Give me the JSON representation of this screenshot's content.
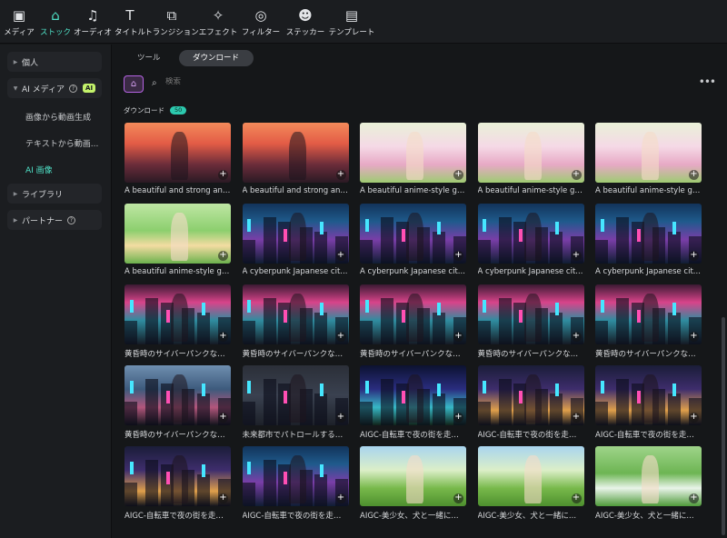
{
  "toolbar": {
    "items": [
      {
        "label": "メディア",
        "icon": "media-icon",
        "glyph": "▣"
      },
      {
        "label": "ストック",
        "icon": "stock-icon",
        "glyph": "⌂",
        "active": true
      },
      {
        "label": "オーディオ",
        "icon": "audio-icon",
        "glyph": "♫"
      },
      {
        "label": "タイトル",
        "icon": "title-icon",
        "glyph": "T"
      },
      {
        "label": "トランジション",
        "icon": "transition-icon",
        "glyph": "⧉"
      },
      {
        "label": "エフェクト",
        "icon": "effect-icon",
        "glyph": "✧"
      },
      {
        "label": "フィルター",
        "icon": "filter-icon",
        "glyph": "◎"
      },
      {
        "label": "ステッカー",
        "icon": "sticker-icon",
        "glyph": "☻"
      },
      {
        "label": "テンプレート",
        "icon": "template-icon",
        "glyph": "▤"
      }
    ]
  },
  "sidebar": {
    "personal": "個人",
    "ai_media": "AI メディア",
    "ai_badge": "AI",
    "sub_items": [
      "画像から動画生成",
      "テキストから動画...",
      "AI 画像"
    ],
    "library": "ライブラリ",
    "partner": "パートナー"
  },
  "main": {
    "tabs": [
      "ツール",
      "ダウンロード"
    ],
    "search_placeholder": "検索",
    "section_label": "ダウンロード",
    "section_count": "50",
    "accent": "#4fe0c6"
  },
  "cards": [
    {
      "caption": "A beautiful and strong ani...",
      "theme": "sunset"
    },
    {
      "caption": "A beautiful and strong ani...",
      "theme": "sunset"
    },
    {
      "caption": "A beautiful anime-style gir...",
      "theme": "girl"
    },
    {
      "caption": "A beautiful anime-style gir...",
      "theme": "girl"
    },
    {
      "caption": "A beautiful anime-style gir...",
      "theme": "girl"
    },
    {
      "caption": "A beautiful anime-style gir...",
      "theme": "meadow"
    },
    {
      "caption": "A cyberpunk Japanese cit...",
      "theme": "city"
    },
    {
      "caption": "A cyberpunk Japanese cit...",
      "theme": "city"
    },
    {
      "caption": "A cyberpunk Japanese cit...",
      "theme": "city"
    },
    {
      "caption": "A cyberpunk Japanese cit...",
      "theme": "city"
    },
    {
      "caption": "黄昏時のサイバーパンクな日...",
      "theme": "alley"
    },
    {
      "caption": "黄昏時のサイバーパンクな日...",
      "theme": "alley"
    },
    {
      "caption": "黄昏時のサイバーパンクな日...",
      "theme": "alley"
    },
    {
      "caption": "黄昏時のサイバーパンクな日...",
      "theme": "alley"
    },
    {
      "caption": "黄昏時のサイバーパンクな日...",
      "theme": "alley"
    },
    {
      "caption": "黄昏時のサイバーパンクな日...",
      "theme": "dusk"
    },
    {
      "caption": "未来都市でパトロールする警...",
      "theme": "dark"
    },
    {
      "caption": "AIGC-自転車で夜の街を走る...",
      "theme": "panda"
    },
    {
      "caption": "AIGC-自転車で夜の街を走る...",
      "theme": "ride"
    },
    {
      "caption": "AIGC-自転車で夜の街を走る...",
      "theme": "ride"
    },
    {
      "caption": "AIGC-自転車で夜の街を走る...",
      "theme": "ride"
    },
    {
      "caption": "AIGC-自転車で夜の街を走る...",
      "theme": "city"
    },
    {
      "caption": "AIGC-美少女、犬と一緒に...",
      "theme": "field"
    },
    {
      "caption": "AIGC-美少女、犬と一緒に...",
      "theme": "field"
    },
    {
      "caption": "AIGC-美少女、犬と一緒に...",
      "theme": "lie"
    }
  ]
}
